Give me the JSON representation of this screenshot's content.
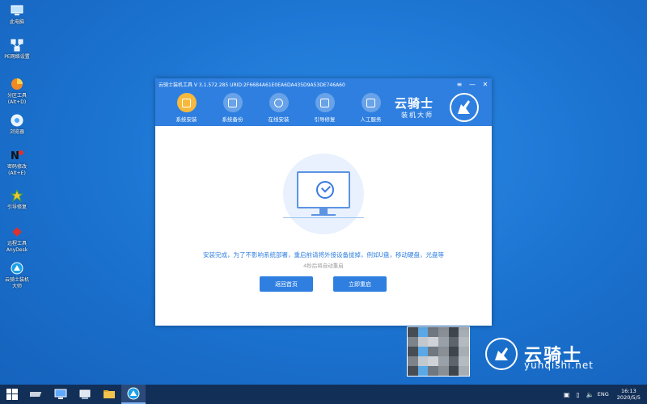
{
  "desktop": {
    "icons": [
      {
        "label": "此电脑",
        "icon": "computer-icon",
        "glyph": "💻"
      },
      {
        "label": "PE网络设置",
        "icon": "network-icon",
        "glyph": "🖧"
      },
      {
        "label": "分区工具\n(Alt+D)",
        "icon": "partition-tool-icon",
        "glyph": "🗂"
      },
      {
        "label": "浏览器",
        "icon": "browser-icon",
        "glyph": "🌐"
      },
      {
        "label": "密码修改\n(Alt+E)",
        "icon": "password-icon",
        "glyph": "🔑"
      },
      {
        "label": "引导修复",
        "icon": "boot-repair-icon",
        "glyph": "✸"
      },
      {
        "label": "远程工具\nAnyDesk",
        "icon": "anydesk-icon",
        "glyph": "◆"
      },
      {
        "label": "云骑士装机\n大师",
        "icon": "yunqishi-icon",
        "glyph": "✪"
      }
    ]
  },
  "watermark": {
    "name_cn": "云骑士",
    "url": "yunqishi.net"
  },
  "window": {
    "title": "云骑士装机工具 V 3.1.572.285 URID:2F66B4A61E0EA6DA435D9A53DE746A60",
    "controls": {
      "menu": "≡",
      "minimize": "—",
      "close": "✕"
    },
    "tabs": [
      {
        "label": "系统安装",
        "active": true
      },
      {
        "label": "系统备份",
        "active": false
      },
      {
        "label": "在线安装",
        "active": false
      },
      {
        "label": "引导修复",
        "active": false
      },
      {
        "label": "人工服务",
        "active": false
      }
    ],
    "logo": {
      "name_cn": "云骑士",
      "subtitle": "装机大师"
    },
    "message": "安装完成，为了不影响系统部署，重启前请将外接设备拔掉，例如U盘，移动硬盘，光盘等",
    "countdown": "4秒后将自动重启",
    "buttons": {
      "home": "返回首页",
      "restart": "立即重启"
    },
    "colors": {
      "primary": "#2f7fe0",
      "active_tab": "#f6b93b"
    }
  },
  "taskbar": {
    "tray": {
      "lang": "ENG",
      "time": "16:13",
      "date": "2020/5/5"
    }
  }
}
